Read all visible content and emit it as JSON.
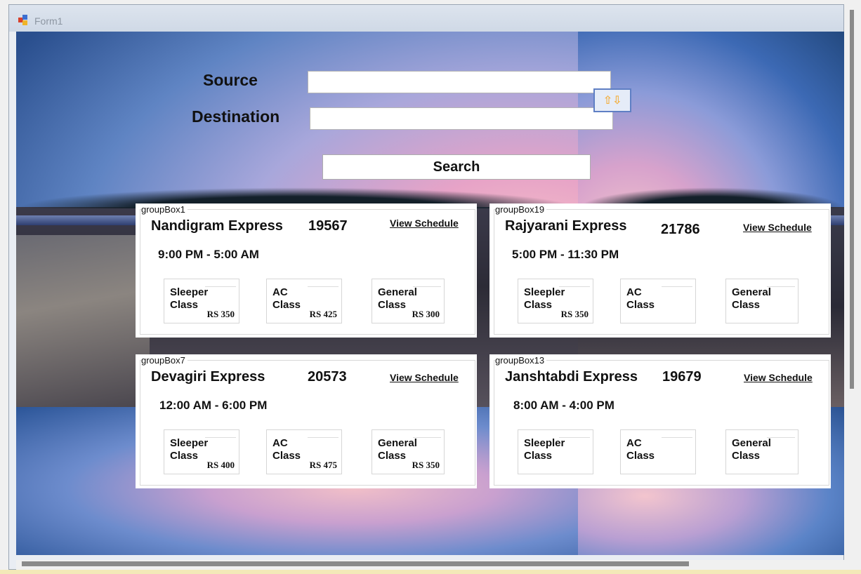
{
  "window": {
    "title": "Form1"
  },
  "search": {
    "source_label": "Source",
    "destination_label": "Destination",
    "source_value": "",
    "destination_value": "",
    "swap_icon": "swap-arrows-icon",
    "swap_glyph": "⇧⇩",
    "search_label": "Search"
  },
  "cards": [
    {
      "group": "groupBox1",
      "name": "Nandigram Express",
      "number": "19567",
      "view": "View Schedule",
      "time": "9:00 PM - 5:00 AM",
      "classes": [
        {
          "name": "Sleeper\nClass",
          "price": "RS 350"
        },
        {
          "name": "AC\nClass",
          "price": "RS 425"
        },
        {
          "name": "General\nClass",
          "price": "RS 300"
        }
      ]
    },
    {
      "group": "groupBox19",
      "name": "Rajyarani Express",
      "number": "21786",
      "view": "View Schedule",
      "time": "5:00 PM - 11:30 PM",
      "classes": [
        {
          "name": "Sleepler\nClass",
          "price": "RS 350"
        },
        {
          "name": "AC\nClass",
          "price": ""
        },
        {
          "name": "General\nClass",
          "price": ""
        }
      ]
    },
    {
      "group": "groupBox7",
      "name": "Devagiri Express",
      "number": "20573",
      "view": "View Schedule",
      "time": "12:00 AM - 6:00 PM",
      "classes": [
        {
          "name": "Sleeper\nClass",
          "price": "RS 400"
        },
        {
          "name": "AC\nClass",
          "price": "RS 475"
        },
        {
          "name": "General\nClass",
          "price": "RS 350"
        }
      ]
    },
    {
      "group": "groupBox13",
      "name": "Janshtabdi Express",
      "number": "19679",
      "view": "View Schedule",
      "time": "8:00 AM - 4:00 PM",
      "classes": [
        {
          "name": "Sleepler\nClass",
          "price": ""
        },
        {
          "name": "AC\nClass",
          "price": ""
        },
        {
          "name": "General\nClass",
          "price": ""
        }
      ]
    }
  ]
}
